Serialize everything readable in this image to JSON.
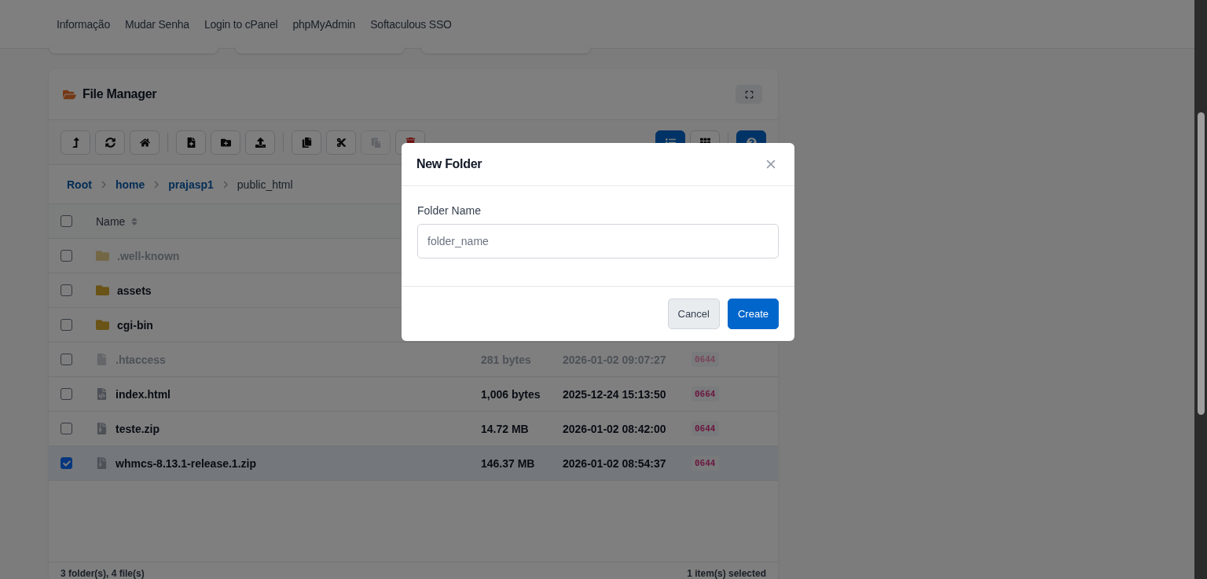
{
  "nav": {
    "links": [
      "Informação",
      "Mudar Senha",
      "Login to cPanel",
      "phpMyAdmin",
      "Softaculous SSO"
    ]
  },
  "summary_cards": [
    {
      "kind": "card"
    },
    {
      "kind": "card"
    },
    {
      "kind": "card"
    }
  ],
  "file_manager": {
    "title": "File Manager",
    "toolbar_buttons": [
      {
        "kind": "up",
        "disabled": false
      },
      {
        "kind": "refresh",
        "disabled": false
      },
      {
        "kind": "home",
        "disabled": false
      },
      {
        "kind": "newfile",
        "disabled": false
      },
      {
        "kind": "newfolder",
        "disabled": false
      },
      {
        "kind": "upload",
        "disabled": false
      },
      {
        "kind": "copy",
        "disabled": false
      },
      {
        "kind": "cut",
        "disabled": false
      },
      {
        "kind": "paste",
        "disabled": true
      },
      {
        "kind": "delete",
        "disabled": false
      }
    ],
    "view_buttons": [
      {
        "kind": "list",
        "selected": true
      },
      {
        "kind": "grid",
        "selected": false
      }
    ],
    "breadcrumbs": [
      {
        "label": "Root",
        "current": false
      },
      {
        "label": "home",
        "current": false
      },
      {
        "label": "prajasp1",
        "current": false
      },
      {
        "label": "public_html",
        "current": true
      }
    ],
    "table": {
      "columns": [
        {
          "label": "Name"
        }
      ],
      "all_checked": false,
      "rows": [
        {
          "name": ".well-known",
          "kind": "folder",
          "hidden": true,
          "checked": false
        },
        {
          "name": "assets",
          "kind": "folder",
          "hidden": false,
          "checked": false
        },
        {
          "name": "cgi-bin",
          "kind": "folder",
          "hidden": false,
          "checked": false
        },
        {
          "name": ".htaccess",
          "kind": "file",
          "hidden": true,
          "checked": false,
          "size": "281 bytes",
          "modified": "2026-01-02 09:07:27",
          "perms": "0644"
        },
        {
          "name": "index.html",
          "kind": "code",
          "hidden": false,
          "checked": false,
          "size": "1,006 bytes",
          "modified": "2025-12-24 15:13:50",
          "perms": "0664"
        },
        {
          "name": "teste.zip",
          "kind": "archive",
          "hidden": false,
          "checked": false,
          "size": "14.72 MB",
          "modified": "2026-01-02 08:42:00",
          "perms": "0644"
        },
        {
          "name": "whmcs-8.13.1-release.1.zip",
          "kind": "archive",
          "hidden": false,
          "checked": true,
          "size": "146.37 MB",
          "modified": "2026-01-02 08:54:37",
          "perms": "0644"
        }
      ]
    },
    "footer": {
      "summary": "3 folder(s), 4 file(s)",
      "selection": "1 item(s) selected"
    }
  },
  "modal": {
    "title": "New Folder",
    "field_label": "Folder Name",
    "placeholder": "folder_name",
    "buttons": [
      {
        "label": "Cancel",
        "kind": "secondary"
      },
      {
        "label": "Create",
        "kind": "primary"
      }
    ]
  }
}
